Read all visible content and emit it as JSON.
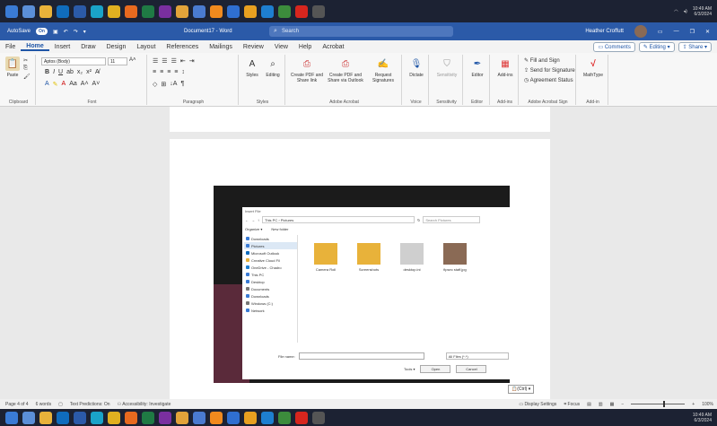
{
  "top_taskbar": {
    "icons": [
      {
        "name": "start-icon",
        "color": "#3a7bd5"
      },
      {
        "name": "taskview-icon",
        "color": "#5b8fd8"
      },
      {
        "name": "file-explorer-icon",
        "color": "#e8b23a"
      },
      {
        "name": "outlook-icon",
        "color": "#0f6cbd"
      },
      {
        "name": "word-icon",
        "color": "#2b5aa8"
      },
      {
        "name": "edge-icon",
        "color": "#1aa3c8"
      },
      {
        "name": "chrome-icon",
        "color": "#e0b020"
      },
      {
        "name": "firefox-icon",
        "color": "#e86a1f"
      },
      {
        "name": "excel-icon",
        "color": "#1f7a44"
      },
      {
        "name": "onenote-icon",
        "color": "#7a2fa0"
      },
      {
        "name": "app-icon",
        "color": "#e2a33a"
      },
      {
        "name": "app-icon-2",
        "color": "#4a7bd0"
      },
      {
        "name": "vlc-icon",
        "color": "#f08a1e"
      },
      {
        "name": "app-icon-3",
        "color": "#2f6fd0"
      },
      {
        "name": "app-icon-4",
        "color": "#e8a020"
      },
      {
        "name": "app-icon-5",
        "color": "#1e7fd0"
      },
      {
        "name": "app-icon-6",
        "color": "#3c8c3c"
      },
      {
        "name": "acrobat-icon",
        "color": "#d7261e"
      },
      {
        "name": "camera-icon",
        "color": "#555"
      }
    ],
    "time": "10:49 AM",
    "date": "6/3/2024"
  },
  "titlebar": {
    "autosave_label": "AutoSave",
    "autosave_state": "On",
    "doc_title": "Document17 - Word",
    "search_placeholder": "Search",
    "user_name": "Heather Croffutt"
  },
  "menu": {
    "tabs": [
      "File",
      "Home",
      "Insert",
      "Draw",
      "Design",
      "Layout",
      "References",
      "Mailings",
      "Review",
      "View",
      "Help",
      "Acrobat"
    ],
    "active_tab": "Home",
    "comments": "Comments",
    "editing": "Editing",
    "share": "Share"
  },
  "ribbon": {
    "clipboard": {
      "paste": "Paste",
      "label": "Clipboard"
    },
    "font": {
      "name": "Aptos (Body)",
      "size": "11",
      "label": "Font"
    },
    "paragraph": {
      "label": "Paragraph"
    },
    "styles": {
      "styles": "Styles",
      "editing": "Editing",
      "label": "Styles"
    },
    "acrobat": {
      "create_pdf": "Create PDF and Share link",
      "create_pdf_share": "Create PDF and Share via Outlook",
      "request": "Request Signatures",
      "label": "Adobe Acrobat"
    },
    "voice": {
      "dictate": "Dictate",
      "label": "Voice"
    },
    "sensitivity": {
      "btn": "Sensitivity",
      "label": "Sensitivity"
    },
    "editor": {
      "btn": "Editor",
      "label": "Editor"
    },
    "addins": {
      "btn": "Add-ins",
      "label": "Add-ins"
    },
    "acrobat_sign": {
      "fill": "Fill and Sign",
      "send": "Send for Signature",
      "agreement": "Agreement Status",
      "label": "Adobe Acrobat Sign"
    },
    "mathtype": {
      "btn": "MathType",
      "label": "Add-in"
    }
  },
  "dialog": {
    "title": "Insert File",
    "address": "This PC › Pictures",
    "search_placeholder": "Search Pictures",
    "organize": "Organize ▾",
    "new_folder": "New folder",
    "nav_items": [
      {
        "label": "Downloads",
        "color": "#3a7bd5"
      },
      {
        "label": "Pictures",
        "color": "#3a7bd5",
        "selected": true
      },
      {
        "label": "Microsoft Outlook",
        "color": "#0f6cbd"
      },
      {
        "label": "Creative Cloud Fil",
        "color": "#e8b23a"
      },
      {
        "label": "OneDrive - Chadro",
        "color": "#1e7fd0"
      },
      {
        "label": "This PC",
        "color": "#3a7bd5"
      },
      {
        "label": "Desktop",
        "color": "#3a7bd5"
      },
      {
        "label": "Documents",
        "color": "#777"
      },
      {
        "label": "Downloads",
        "color": "#3a7bd5"
      },
      {
        "label": "Windows (C:)",
        "color": "#777"
      },
      {
        "label": "Network",
        "color": "#3a7bd5"
      }
    ],
    "files": [
      {
        "label": "Camera Roll",
        "color": "#e8b23a"
      },
      {
        "label": "Screenshots",
        "color": "#e8b23a"
      },
      {
        "label": "desktop.ini",
        "color": "#cfcfcf"
      },
      {
        "label": "fipsec staff.jpg",
        "color": "#8a6a55"
      }
    ],
    "filename_label": "File name:",
    "filetype": "All Files (*.*)",
    "tools": "Tools",
    "open": "Open",
    "cancel": "Cancel"
  },
  "paste_options": "(Ctrl)",
  "statusbar": {
    "page": "Page 4 of 4",
    "words": "6 words",
    "predictions": "Text Predictions: On",
    "accessibility": "Accessibility: Investigate",
    "display": "Display Settings",
    "focus": "Focus",
    "zoom": "100%"
  }
}
